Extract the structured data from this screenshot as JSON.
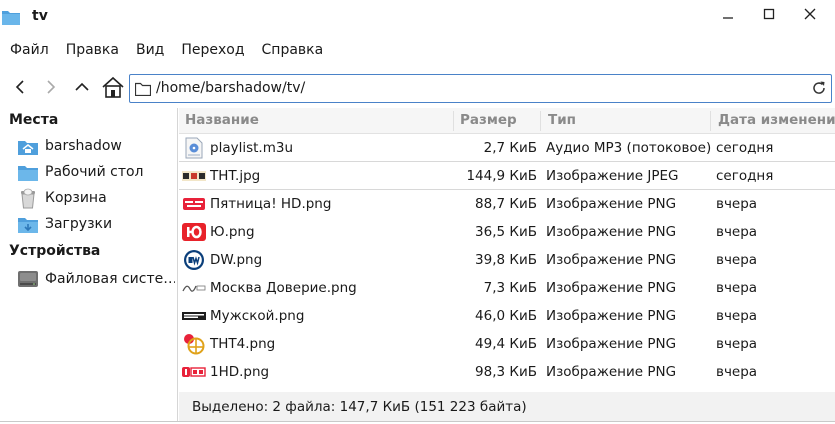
{
  "window": {
    "title": "tv",
    "controls": [
      "minimize-icon",
      "maximize-icon",
      "close-icon"
    ]
  },
  "menu": {
    "items": [
      "Файл",
      "Правка",
      "Вид",
      "Переход",
      "Справка"
    ]
  },
  "address": {
    "path": "/home/barshadow/tv/"
  },
  "sidebar": {
    "places_heading": "Места",
    "places": [
      {
        "label": "barshadow",
        "icon": "home-folder-icon"
      },
      {
        "label": "Рабочий стол",
        "icon": "desktop-folder-icon"
      },
      {
        "label": "Корзина",
        "icon": "trash-icon"
      },
      {
        "label": "Загрузки",
        "icon": "downloads-folder-icon"
      }
    ],
    "devices_heading": "Устройства",
    "devices": [
      {
        "label": "Файловая систе…",
        "icon": "drive-icon"
      }
    ]
  },
  "columns": {
    "name": "Название",
    "size": "Размер",
    "type": "Тип",
    "date": "Дата изменени"
  },
  "files": [
    {
      "name": "playlist.m3u",
      "size": "2,7 КиБ",
      "type": "Аудио MP3 (потоковое)",
      "date": "сегодня",
      "selected": true
    },
    {
      "name": "THT.jpg",
      "size": "144,9 КиБ",
      "type": "Изображение JPEG",
      "date": "сегодня",
      "selected": true
    },
    {
      "name": "Пятница! HD.png",
      "size": "88,7 КиБ",
      "type": "Изображение PNG",
      "date": "вчера",
      "selected": false
    },
    {
      "name": "Ю.png",
      "size": "36,5 КиБ",
      "type": "Изображение PNG",
      "date": "вчера",
      "selected": false
    },
    {
      "name": "DW.png",
      "size": "39,8 КиБ",
      "type": "Изображение PNG",
      "date": "вчера",
      "selected": false
    },
    {
      "name": "Москва Доверие.png",
      "size": "7,3 КиБ",
      "type": "Изображение PNG",
      "date": "вчера",
      "selected": false
    },
    {
      "name": "Мужской.png",
      "size": "46,0 КиБ",
      "type": "Изображение PNG",
      "date": "вчера",
      "selected": false
    },
    {
      "name": "THT4.png",
      "size": "49,4 КиБ",
      "type": "Изображение PNG",
      "date": "вчера",
      "selected": false
    },
    {
      "name": "1HD.png",
      "size": "98,3 КиБ",
      "type": "Изображение PNG",
      "date": "вчера",
      "selected": false
    }
  ],
  "status": {
    "text": "Выделено: 2 файла: 147,7 КиБ (151 223 байта)"
  },
  "colors": {
    "accent": "#4a82c8",
    "folder": "#5aa7e0"
  }
}
